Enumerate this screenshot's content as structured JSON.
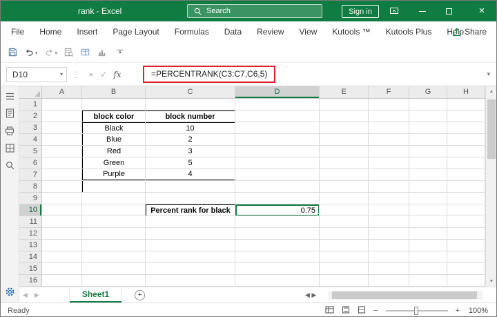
{
  "window": {
    "title": "rank - Excel",
    "search_placeholder": "Search",
    "sign_in_label": "Sign in"
  },
  "menu": {
    "items": [
      "File",
      "Home",
      "Insert",
      "Page Layout",
      "Formulas",
      "Data",
      "Review",
      "View",
      "Kutools ™",
      "Kutools Plus",
      "Help"
    ],
    "share_label": "Share"
  },
  "qat": {
    "icons": [
      "save-icon",
      "undo-icon",
      "redo-icon",
      "print-preview-icon",
      "table-icon",
      "chart-icon",
      "customize-qat-icon"
    ]
  },
  "formula_bar": {
    "name_box": "D10",
    "formula": "=PERCENTRANK(C3:C7,C6,5)"
  },
  "sidebar": {
    "icons": [
      "menu-icon",
      "document-icon",
      "printer-icon",
      "grid-icon",
      "magnifier-icon",
      "settings-gear-icon"
    ]
  },
  "grid": {
    "columns": [
      "A",
      "B",
      "C",
      "D",
      "E",
      "F",
      "G",
      "H"
    ],
    "row_count": 16,
    "selected_column": "D",
    "selected_row": 10
  },
  "sheet_data": {
    "table": {
      "headers": [
        "block color",
        "block number"
      ],
      "rows": [
        [
          "Black",
          "10"
        ],
        [
          "Blue",
          "2"
        ],
        [
          "Red",
          "3"
        ],
        [
          "Green",
          "5"
        ],
        [
          "Purple",
          "4"
        ],
        [
          "",
          ""
        ]
      ]
    },
    "result_label": "Percent rank for black",
    "result_value": "0.75"
  },
  "sheet_tabs": {
    "active": "Sheet1"
  },
  "status_bar": {
    "status": "Ready",
    "zoom": "100%"
  },
  "colors": {
    "excel_green": "#107C41",
    "highlight_red": "#E0202C",
    "selection_border": "#107C41"
  }
}
